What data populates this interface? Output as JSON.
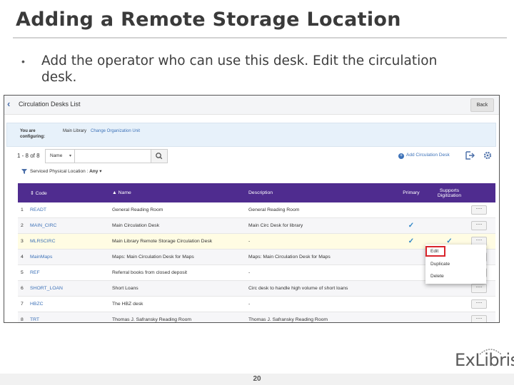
{
  "slide": {
    "title": "Adding a Remote Storage Location",
    "bullet": "Add the operator who can use this desk.  Edit the circulation desk.",
    "page_number": "20",
    "logo_text": "ExLibris"
  },
  "screen": {
    "header": {
      "title": "Circulation Desks List",
      "back_label": "Back"
    },
    "context": {
      "label": "You are configuring:",
      "value": "Main Library",
      "change_link": "Change Organization Unit"
    },
    "toolbar": {
      "count": "1 - 8 of 8",
      "search_field_option": "Name",
      "search_value": "",
      "add_link": "Add Circulation Desk"
    },
    "filter": {
      "label": "Serviced Physical Location :",
      "value": "Any"
    },
    "table": {
      "headers": {
        "code": "Code",
        "name": "Name",
        "description": "Description",
        "primary": "Primary",
        "digitization": "Supports Digitization"
      },
      "rows": [
        {
          "num": "1",
          "code": "READT",
          "name": "General Reading Room",
          "description": "General Reading Room",
          "primary": false,
          "digitization": false
        },
        {
          "num": "2",
          "code": "MAIN_CIRC",
          "name": "Main Circulation Desk",
          "description": "Main Circ Desk for library",
          "primary": true,
          "digitization": false
        },
        {
          "num": "3",
          "code": "MLRSCIRC",
          "name": "Main Library Remote Storage Circulation Desk",
          "description": "-",
          "primary": true,
          "digitization": true
        },
        {
          "num": "4",
          "code": "MainMaps",
          "name": "Maps: Main Circulation Desk for Maps",
          "description": "Maps: Main Circulation Desk for Maps",
          "primary": false,
          "digitization": false
        },
        {
          "num": "5",
          "code": "REF",
          "name": "Referral books from closed deposit",
          "description": "-",
          "primary": false,
          "digitization": false
        },
        {
          "num": "6",
          "code": "SHORT_LOAN",
          "name": "Short Loans",
          "description": "Circ desk to handle high volume of short loans",
          "primary": false,
          "digitization": false
        },
        {
          "num": "7",
          "code": "HBZC",
          "name": "The HBZ desk",
          "description": "-",
          "primary": false,
          "digitization": false
        },
        {
          "num": "8",
          "code": "TRT",
          "name": "Thomas J. Safransky Reading Room",
          "description": "Thomas J. Safransky Reading Room",
          "primary": false,
          "digitization": false
        }
      ],
      "more_label": "···",
      "check_glyph": "✓"
    },
    "row_menu": {
      "items": [
        "Edit",
        "Duplicate",
        "Delete"
      ],
      "highlighted": "Edit"
    },
    "colors": {
      "header_purple": "#4f2c8f",
      "link_blue": "#3d72b8",
      "highlight_row": "#fffce3",
      "callout_red": "#d9242b"
    }
  }
}
